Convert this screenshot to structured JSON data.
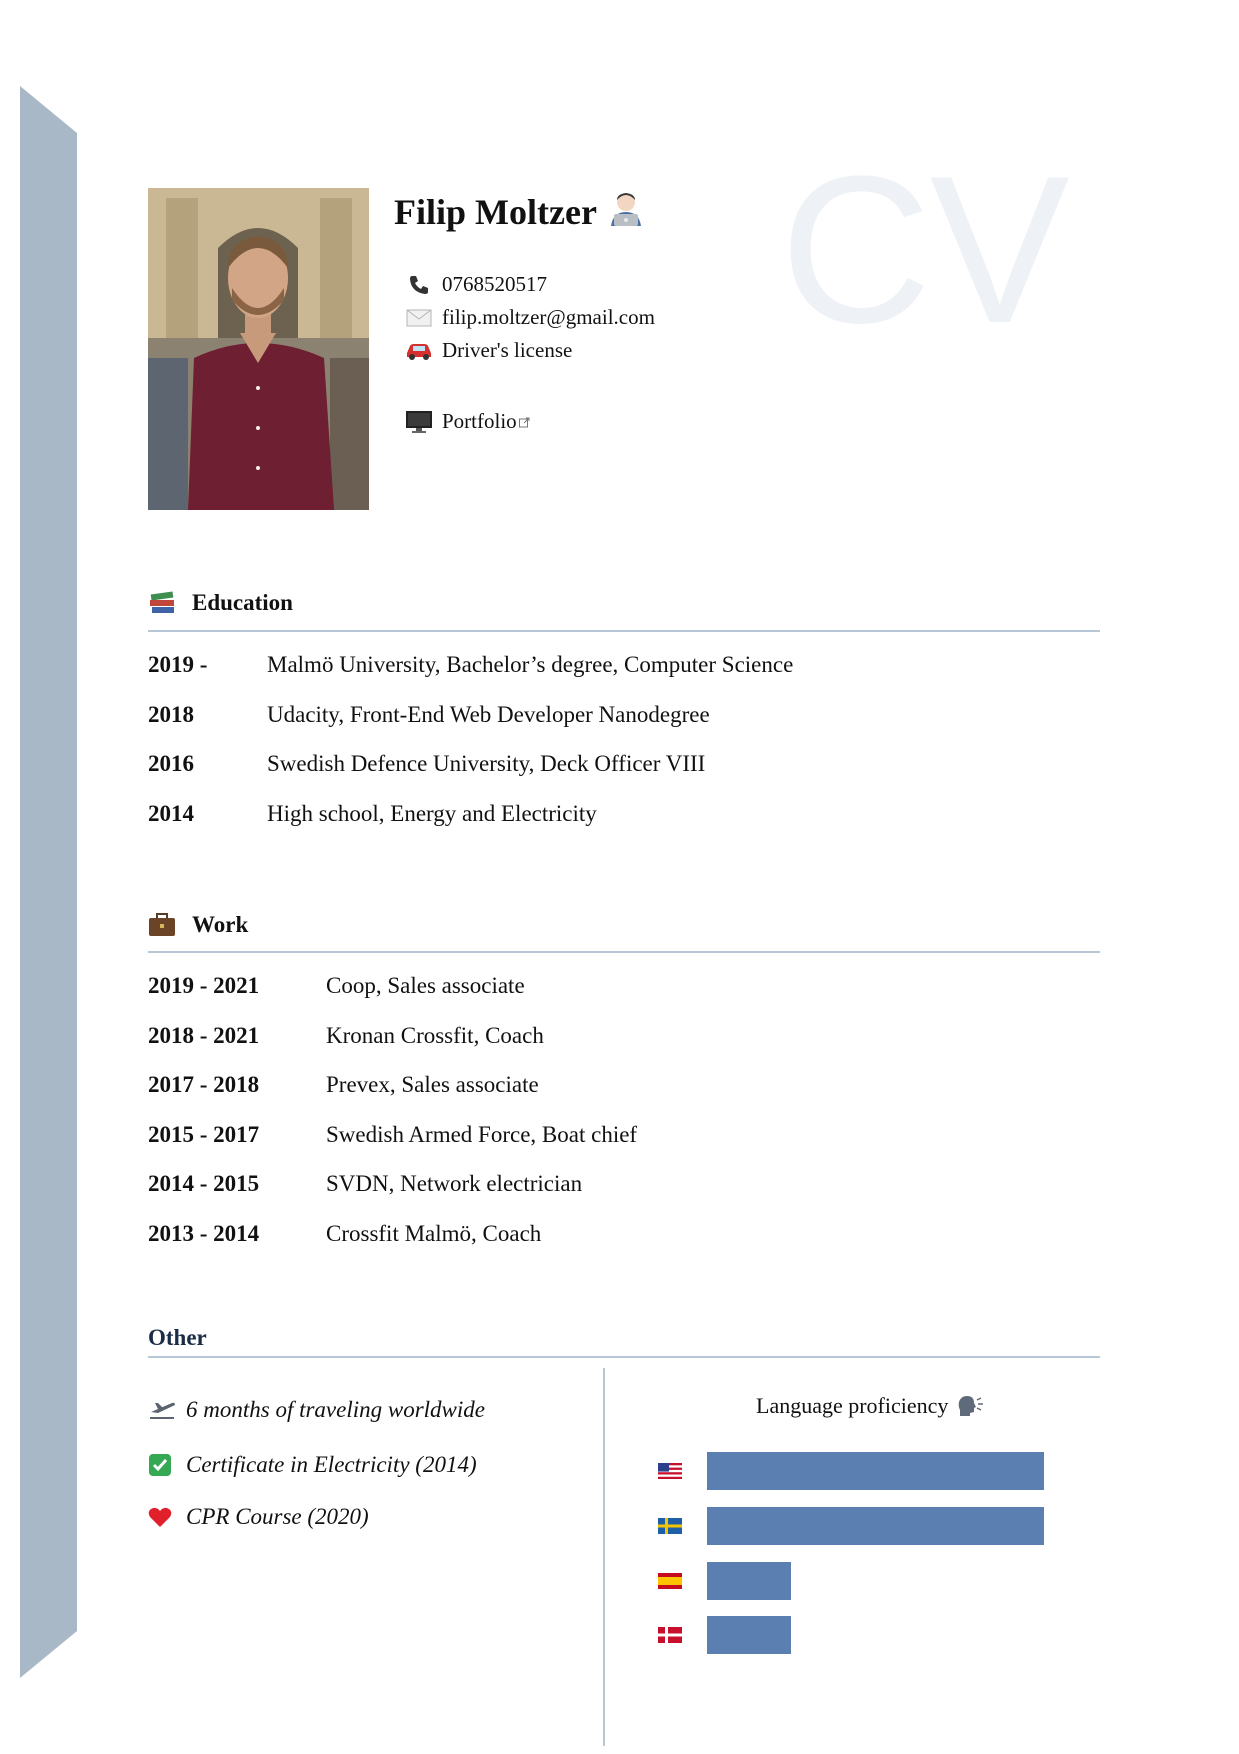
{
  "page": {
    "watermark": "CV"
  },
  "header": {
    "name": "Filip Moltzer",
    "photo_alt": "Filip Moltzer",
    "contacts": [
      {
        "icon": "telephone-icon",
        "text": "0768520517"
      },
      {
        "icon": "envelope-icon",
        "text": "filip.moltzer@gmail.com"
      },
      {
        "icon": "car-icon",
        "text": "Driver's license"
      },
      {
        "icon": "computer-icon",
        "text": "Portfolio"
      }
    ]
  },
  "education": {
    "title": "Education",
    "icon": "books-icon",
    "items": [
      {
        "year": "2019 -",
        "text": "Malmö University, Bachelor’s degree, Computer Science"
      },
      {
        "year": "2018",
        "text": "Udacity, Front-End Web Developer Nanodegree"
      },
      {
        "year": "2016",
        "text": "Swedish Defence University, Deck Officer VIII"
      },
      {
        "year": "2014",
        "text": "High school, Energy and Electricity"
      }
    ]
  },
  "work": {
    "title": "Work",
    "icon": "briefcase-icon",
    "items": [
      {
        "year": "2019 - 2021",
        "text": "Coop, Sales associate"
      },
      {
        "year": "2018 - 2021",
        "text": "Kronan Crossfit, Coach"
      },
      {
        "year": "2017 - 2018",
        "text": "Prevex, Sales associate"
      },
      {
        "year": "2015 - 2017",
        "text": "Swedish Armed Force, Boat chief"
      },
      {
        "year": "2014 - 2015",
        "text": "SVDN, Network electrician"
      },
      {
        "year": "2013 - 2014",
        "text": "Crossfit Malmö, Coach"
      }
    ]
  },
  "other": {
    "title": "Other",
    "items": [
      {
        "icon": "airplane-departure-icon",
        "text": "6 months of traveling worldwide"
      },
      {
        "icon": "check-mark-icon",
        "text": "Certificate in Electricity (2014)"
      },
      {
        "icon": "heart-icon",
        "text": "CPR Course (2020)"
      }
    ]
  },
  "languages": {
    "title": "Language proficiency",
    "icon": "speaking-head-icon",
    "items": [
      {
        "flag": "us-flag-icon",
        "level": 1.0
      },
      {
        "flag": "sweden-flag-icon",
        "level": 1.0
      },
      {
        "flag": "spain-flag-icon",
        "level": 0.25
      },
      {
        "flag": "denmark-flag-icon",
        "level": 0.25
      }
    ]
  },
  "colors": {
    "side_band": "#a8b8c7",
    "rule": "#b7c7d6",
    "bar": "#5a7fb0",
    "watermark": "#eef2f6",
    "other_heading": "#1b2c45"
  }
}
